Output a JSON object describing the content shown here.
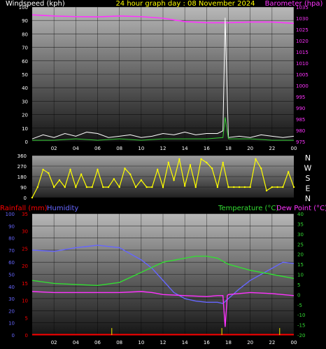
{
  "header": {
    "windspeed_label": "Windspeed (kph)",
    "title": "24 hour graph day : 08 November 2024",
    "barometer_label": "Barometer (hpa)"
  },
  "compass": [
    "N",
    "W",
    "S",
    "E",
    "N"
  ],
  "lower_header": {
    "rainfall_label": "Rainfall (mm)",
    "humidity_label": "Humidity",
    "temperature_label": "Temperature (°C)",
    "dewpoint_label": "Dew Point (°C)"
  },
  "colors": {
    "wind": "#ffffff",
    "gust": "#33cc33",
    "barometer": "#ff33ff",
    "direction": "#ffff00",
    "rainfall": "#ff0000",
    "humidity": "#6666ff",
    "temperature": "#33dd33",
    "dewpoint": "#ff33ff",
    "rain_bar": "#cccc00"
  },
  "chart_data": [
    {
      "type": "line",
      "name": "wind-barometer",
      "x_ticks": [
        "02",
        "04",
        "06",
        "08",
        "10",
        "12",
        "14",
        "16",
        "18",
        "20",
        "22",
        "00"
      ],
      "y_left": {
        "label": "Windspeed (kph)",
        "ticks": [
          0,
          10,
          20,
          30,
          40,
          50,
          60,
          70,
          80,
          90,
          100
        ],
        "ylim": [
          0,
          100
        ]
      },
      "y_right": {
        "label": "Barometer (hpa)",
        "ticks": [
          975,
          980,
          985,
          990,
          995,
          1000,
          1005,
          1010,
          1015,
          1020,
          1025,
          1030,
          1035
        ],
        "ylim": [
          975,
          1035
        ]
      },
      "series": [
        {
          "name": "Barometer (hpa)",
          "axis": "right",
          "x": [
            0,
            2,
            4,
            6,
            8,
            10,
            12,
            14,
            16,
            18,
            20,
            22,
            24
          ],
          "y": [
            1031.5,
            1031,
            1030.7,
            1030.6,
            1031,
            1030.7,
            1030,
            1028.5,
            1028,
            1028,
            1028.3,
            1028.3,
            1027.7
          ]
        },
        {
          "axis": "left",
          "x": [
            0,
            1,
            2,
            3,
            4,
            5,
            6,
            7,
            8,
            9,
            10,
            11,
            12,
            13,
            14,
            15,
            16,
            17,
            17.5,
            17.7,
            18,
            19,
            20,
            21,
            22,
            23,
            24
          ],
          "y": [
            2,
            5,
            3,
            6,
            4,
            7,
            6,
            3,
            4,
            5,
            3,
            4,
            6,
            5,
            7,
            5,
            6,
            6,
            8,
            92,
            3,
            4,
            3,
            5,
            4,
            3,
            4
          ]
        },
        {
          "axis": "left",
          "x": [
            0,
            2,
            4,
            6,
            8,
            10,
            12,
            14,
            16,
            17.5,
            17.7,
            18,
            20,
            22,
            24
          ],
          "y": [
            1,
            1,
            2,
            1,
            2,
            1,
            2,
            2,
            2,
            3,
            18,
            2,
            2,
            1,
            1
          ]
        }
      ]
    },
    {
      "type": "scatter",
      "name": "wind-direction",
      "y_ticks": [
        0,
        90,
        180,
        270,
        360
      ],
      "ylim": [
        0,
        360
      ],
      "x": [
        0,
        0.5,
        1,
        1.5,
        2,
        2.5,
        3,
        3.5,
        4,
        4.5,
        5,
        5.5,
        6,
        6.5,
        7,
        7.5,
        8,
        8.5,
        9,
        9.5,
        10,
        10.5,
        11,
        11.5,
        12,
        12.5,
        13,
        13.5,
        14,
        14.5,
        15,
        15.5,
        16,
        16.5,
        17,
        17.5,
        18,
        18.5,
        19,
        19.5,
        20,
        20.5,
        21,
        21.5,
        22,
        22.5,
        23,
        23.5,
        24
      ],
      "y": [
        0,
        90,
        240,
        210,
        90,
        150,
        90,
        240,
        90,
        200,
        90,
        90,
        240,
        90,
        90,
        160,
        90,
        250,
        200,
        90,
        150,
        90,
        90,
        240,
        90,
        300,
        150,
        330,
        100,
        280,
        90,
        330,
        300,
        250,
        90,
        300,
        90,
        90,
        90,
        90,
        90,
        330,
        250,
        60,
        90,
        90,
        90,
        220,
        90
      ]
    },
    {
      "type": "line",
      "name": "rain-humidity-temp-dew",
      "x_ticks": [
        "02",
        "04",
        "06",
        "08",
        "10",
        "12",
        "14",
        "16",
        "18",
        "20",
        "22",
        "00"
      ],
      "y_left_humidity": {
        "label": "Humidity",
        "ticks": [
          0,
          10,
          20,
          30,
          40,
          50,
          60,
          70,
          80,
          90,
          100
        ],
        "ylim": [
          0,
          100
        ]
      },
      "y_left_rain": {
        "label": "Rainfall (mm)",
        "ticks": [
          0,
          5,
          10,
          15,
          20,
          25,
          30,
          35
        ],
        "ylim": [
          0,
          35
        ]
      },
      "y_right_temp": {
        "label": "Temperature (°C)",
        "ticks": [
          -20,
          -15,
          -10,
          -5,
          0,
          5,
          10,
          15,
          20,
          25,
          30,
          35,
          40
        ],
        "ylim": [
          -20,
          40
        ]
      },
      "series": [
        {
          "name": "Humidity",
          "axis": "humidity",
          "x": [
            0,
            2,
            4,
            6,
            8,
            10,
            11,
            12,
            13,
            14,
            15,
            16,
            17,
            17.5,
            18,
            19,
            20,
            21,
            22,
            23,
            24
          ],
          "y": [
            70,
            69,
            72,
            74,
            72,
            62,
            55,
            45,
            35,
            30,
            28,
            27,
            27,
            26,
            30,
            38,
            45,
            50,
            55,
            60,
            59
          ]
        },
        {
          "name": "Temperature (°C)",
          "axis": "temp",
          "x": [
            0,
            2,
            4,
            6,
            8,
            10,
            12,
            14,
            15,
            16,
            17,
            18,
            20,
            22,
            24
          ],
          "y": [
            7,
            5.5,
            5,
            4.5,
            6,
            11,
            16,
            18,
            19,
            19,
            18,
            15,
            12,
            10,
            8
          ]
        },
        {
          "name": "Dew Point (°C)",
          "axis": "temp",
          "x": [
            0,
            2,
            4,
            6,
            8,
            10,
            11,
            12,
            14,
            16,
            17,
            17.5,
            17.7,
            17.9,
            18,
            20,
            22,
            24
          ],
          "y": [
            1.5,
            1,
            1,
            1,
            1,
            1.5,
            1,
            0,
            -0.5,
            -1,
            -0.5,
            -0.5,
            -16,
            -0.5,
            0,
            1,
            0.5,
            -0.5
          ]
        },
        {
          "name": "Rainfall (mm)",
          "axis": "rain",
          "x": [
            0,
            24
          ],
          "y": [
            0.1,
            0.1
          ]
        }
      ],
      "rain_bars": [
        {
          "x": 7.3,
          "y": 2
        },
        {
          "x": 17.4,
          "y": 2
        },
        {
          "x": 22.7,
          "y": 2
        }
      ]
    }
  ]
}
